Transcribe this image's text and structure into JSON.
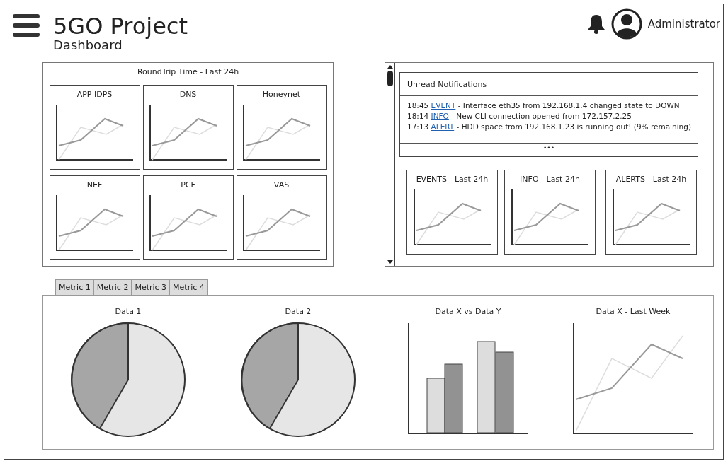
{
  "header": {
    "title": "5GO Project",
    "subtitle": "Dashboard",
    "user": "Administrator"
  },
  "roundtrip": {
    "title": "RoundTrip Time - Last 24h",
    "charts": [
      "APP IDPS",
      "DNS",
      "Honeynet",
      "NEF",
      "PCF",
      "VAS"
    ]
  },
  "notifications": {
    "title": "Unread Notifications",
    "items": [
      {
        "time": "18:45",
        "type": "EVENT",
        "message": "- Interface eth35 from 192.168.1.4 changed state to DOWN"
      },
      {
        "time": "18:14",
        "type": "INFO",
        "message": "- New CLI connection opened from 172.157.2.25"
      },
      {
        "time": "17:13",
        "type": "ALERT",
        "message": "- HDD space from 192.168.1.23 is running out! (9% remaining)"
      }
    ],
    "more": "•••"
  },
  "summary_charts": [
    "EVENTS - Last 24h",
    "INFO - Last 24h",
    "ALERTS - Last 24h"
  ],
  "tabs": [
    {
      "label": "Metric 1"
    },
    {
      "label": "Metric 2"
    },
    {
      "label": "Metric 3"
    },
    {
      "label": "Metric 4"
    }
  ],
  "metric_charts": [
    {
      "kind": "pie",
      "title": "Data 1"
    },
    {
      "kind": "pie",
      "title": "Data 2"
    },
    {
      "kind": "bar",
      "title": "Data X vs Data Y"
    },
    {
      "kind": "line",
      "title": "Data X - Last Week"
    }
  ]
}
